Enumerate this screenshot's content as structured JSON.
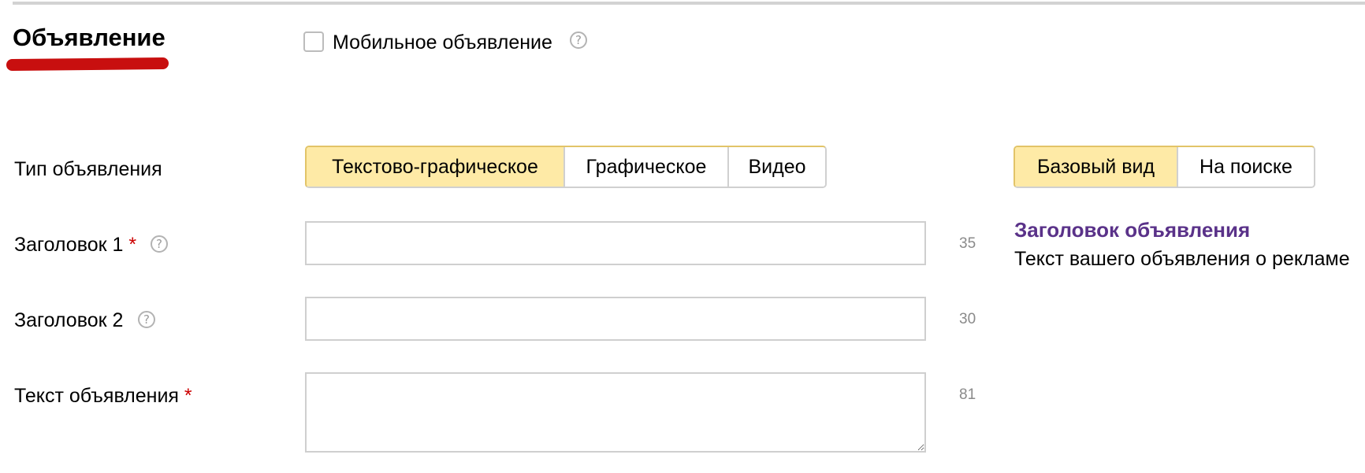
{
  "section": {
    "title": "Объявление"
  },
  "mobile": {
    "label": "Мобильное объявление",
    "checked": false
  },
  "help_icon_glyph": "?",
  "ad_type": {
    "label": "Тип объявления",
    "options": [
      "Текстово-графическое",
      "Графическое",
      "Видео"
    ],
    "selected": "Текстово-графическое"
  },
  "view_mode": {
    "options": [
      "Базовый вид",
      "На поиске"
    ],
    "selected": "Базовый вид"
  },
  "fields": {
    "title1": {
      "label": "Заголовок 1",
      "required_mark": "*",
      "value": "",
      "counter": "35"
    },
    "title2": {
      "label": "Заголовок 2",
      "value": "",
      "counter": "30"
    },
    "text": {
      "label": "Текст объявления",
      "required_mark": "*",
      "value": "",
      "counter": "81"
    }
  },
  "preview": {
    "title": "Заголовок объявления",
    "text": "Текст вашего объявления о рекламе"
  },
  "colors": {
    "accent_underline": "#c80f0f",
    "selected_button_bg": "#feeaa6",
    "preview_title": "#5a3289",
    "required_mark": "#cc0000"
  },
  "icons": [
    "help-icon",
    "checkbox"
  ]
}
